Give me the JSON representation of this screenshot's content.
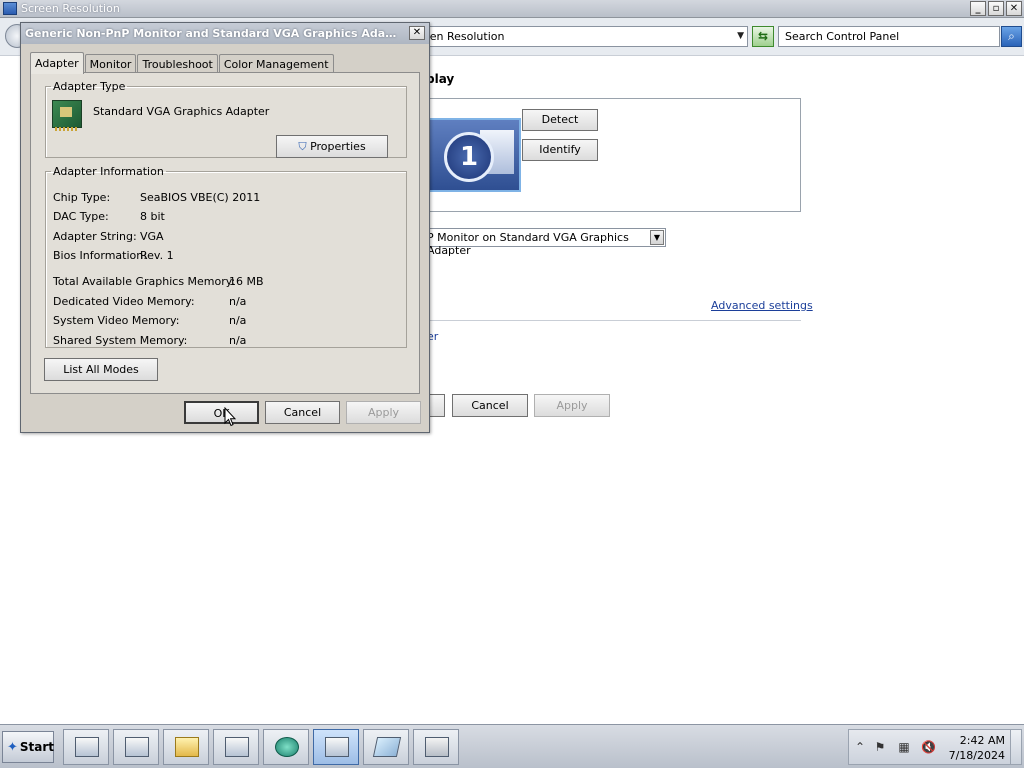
{
  "main_window": {
    "title": "Screen Resolution",
    "address_text": "een Resolution",
    "search_placeholder": "Search Control Panel",
    "caption_buttons": [
      "_",
      "▫",
      "✕"
    ],
    "heading_fragment": "play",
    "monitor_number": "1",
    "detect_label": "Detect",
    "identify_label": "Identify",
    "display_value": "P Monitor on Standard VGA Graphics Adapter",
    "advanced_settings_label": "Advanced settings",
    "link_fragment": "er",
    "ok_fragment": "",
    "cancel_label": "Cancel",
    "apply_label": "Apply"
  },
  "dialog": {
    "title": "Generic Non-PnP Monitor and Standard VGA Graphics Adapter Pro...",
    "close_label": "✕",
    "tabs": [
      {
        "label": "Adapter",
        "active": true
      },
      {
        "label": "Monitor",
        "active": false
      },
      {
        "label": "Troubleshoot",
        "active": false
      },
      {
        "label": "Color Management",
        "active": false
      }
    ],
    "adapter_type": {
      "legend": "Adapter Type",
      "name": "Standard VGA Graphics Adapter",
      "properties_label": "Properties"
    },
    "adapter_info": {
      "legend": "Adapter Information",
      "rows": [
        {
          "label": "Chip Type:",
          "value": "SeaBIOS VBE(C) 2011"
        },
        {
          "label": "DAC Type:",
          "value": "8 bit"
        },
        {
          "label": "Adapter String:",
          "value": "VGA"
        },
        {
          "label": "Bios Information:",
          "value": "Rev. 1"
        }
      ],
      "memory_rows": [
        {
          "label": "Total Available Graphics Memory:",
          "value": "16 MB"
        },
        {
          "label": "Dedicated Video Memory:",
          "value": "n/a"
        },
        {
          "label": "System Video Memory:",
          "value": "n/a"
        },
        {
          "label": "Shared System Memory:",
          "value": "n/a"
        }
      ]
    },
    "list_all_modes_label": "List All Modes",
    "ok_label": "OK",
    "cancel_label": "Cancel",
    "apply_label": "Apply"
  },
  "taskbar": {
    "start_label": "Start",
    "apps": [
      "server-manager",
      "powershell",
      "explorer",
      "command-window",
      "browser",
      "screen-resolution",
      "notepad",
      "calculator"
    ],
    "tray": {
      "time": "2:42 AM",
      "date": "7/18/2024"
    }
  },
  "colors": {
    "link": "#1c3f9a",
    "dialog_face": "#d4d0c8",
    "taskbar": "#c9d0da"
  }
}
